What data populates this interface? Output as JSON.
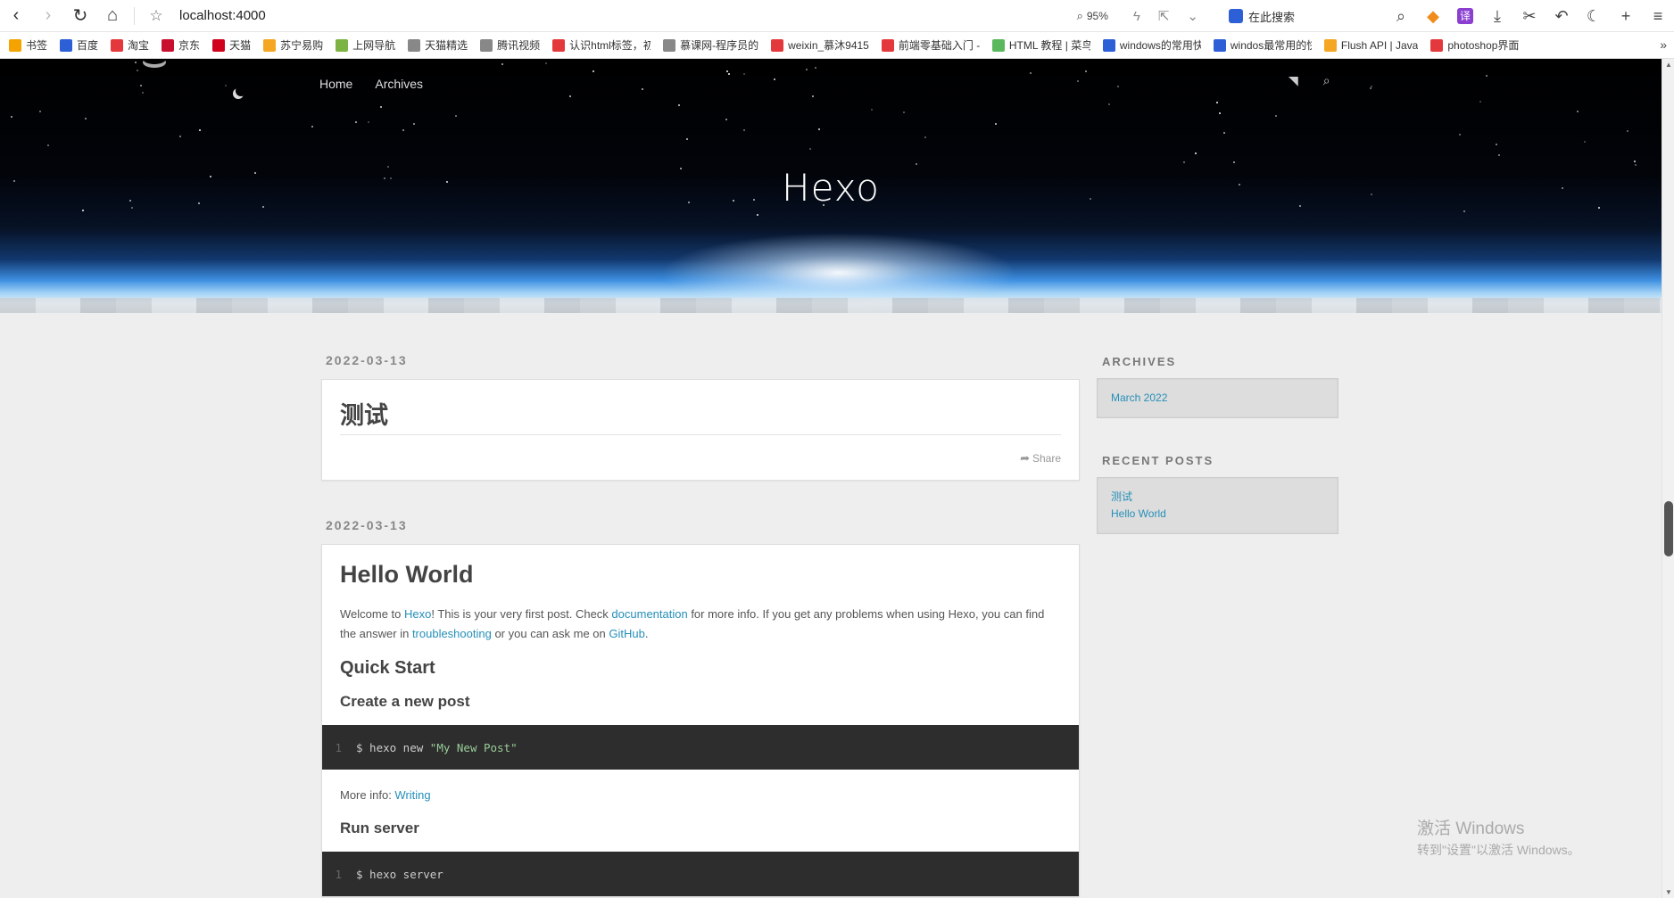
{
  "browser": {
    "url": "localhost:4000",
    "zoom": "95%",
    "search_placeholder": "在此搜索",
    "bookmarks": [
      {
        "label": "书签",
        "color": "#f4a300"
      },
      {
        "label": "百度",
        "color": "#2d5fd6"
      },
      {
        "label": "淘宝",
        "color": "#e4393c"
      },
      {
        "label": "京东",
        "color": "#c8102e"
      },
      {
        "label": "天猫",
        "color": "#d0021b"
      },
      {
        "label": "苏宁易购",
        "color": "#f5a623"
      },
      {
        "label": "上网导航",
        "color": "#7cb342"
      },
      {
        "label": "天猫精选",
        "color": "#888888"
      },
      {
        "label": "腾讯视频",
        "color": "#888888"
      },
      {
        "label": "认识html标签，初",
        "color": "#e4393c"
      },
      {
        "label": "慕课网-程序员的",
        "color": "#888888"
      },
      {
        "label": "weixin_慕沐9415",
        "color": "#e4393c"
      },
      {
        "label": "前端零基础入门 -",
        "color": "#e4393c"
      },
      {
        "label": "HTML 教程 | 菜鸟",
        "color": "#5cb85c"
      },
      {
        "label": "windows的常用快",
        "color": "#2d5fd6"
      },
      {
        "label": "windos最常用的快",
        "color": "#2d5fd6"
      },
      {
        "label": "Flush API | Java",
        "color": "#f5a623"
      },
      {
        "label": "photoshop界面",
        "color": "#e4393c"
      }
    ]
  },
  "site": {
    "title": "Hexo",
    "nav": [
      "Home",
      "Archives"
    ]
  },
  "posts": [
    {
      "date": "2022-03-13",
      "title": "测试",
      "share": "Share"
    },
    {
      "date": "2022-03-13",
      "title": "Hello World",
      "intro": {
        "p1": "Welcome to ",
        "l1": "Hexo",
        "p2": "! This is your very first post. Check ",
        "l2": "documentation",
        "p3": " for more info. If you get any problems when using Hexo, you can find the answer in ",
        "l3": "troubleshooting",
        "p4": " or you can ask me on ",
        "l4": "GitHub",
        "p5": "."
      },
      "quick_start": "Quick Start",
      "create_post": "Create a new post",
      "code1": {
        "line": "1",
        "cmd": "$ hexo new ",
        "arg": "\"My New Post\""
      },
      "more_info_label": "More info: ",
      "more_info_link": "Writing",
      "run_server": "Run server",
      "code2": {
        "line": "1",
        "cmd": "$ hexo server"
      }
    }
  ],
  "sidebar": {
    "archives_title": "ARCHIVES",
    "archives": [
      "March 2022"
    ],
    "recent_title": "RECENT POSTS",
    "recent": [
      "测试",
      "Hello World"
    ]
  },
  "watermark": {
    "line1": "激活 Windows",
    "line2": "转到\"设置\"以激活 Windows。"
  }
}
